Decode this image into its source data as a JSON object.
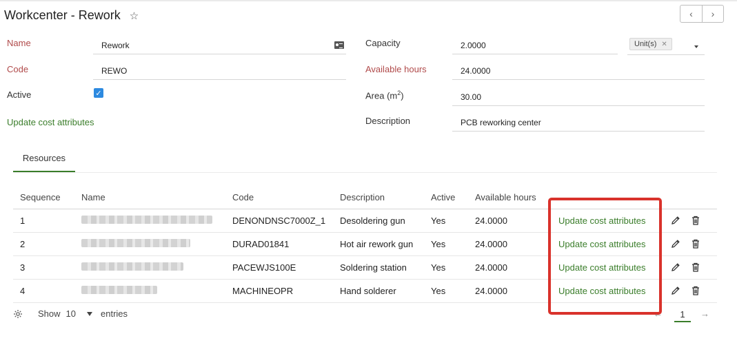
{
  "header": {
    "title": "Workcenter - Rework"
  },
  "form": {
    "name_label": "Name",
    "name_value": "Rework",
    "code_label": "Code",
    "code_value": "REWO",
    "active_label": "Active",
    "update_cost_link": "Update cost attributes",
    "capacity_label": "Capacity",
    "capacity_value": "2.0000",
    "capacity_unit": "Unit(s)",
    "available_hours_label": "Available hours",
    "available_hours_value": "24.0000",
    "area_label": "Area (m",
    "area_sup": "2",
    "area_label_end": ")",
    "area_value": "30.00",
    "description_label": "Description",
    "description_value": "PCB reworking center"
  },
  "tabs": {
    "resources": "Resources"
  },
  "table": {
    "headers": {
      "sequence": "Sequence",
      "name": "Name",
      "code": "Code",
      "description": "Description",
      "active": "Active",
      "available_hours": "Available hours"
    },
    "rows": [
      {
        "sequence": "1",
        "code": "DENONDNSC7000Z_1",
        "description": "Desoldering gun",
        "active": "Yes",
        "hours": "24.0000",
        "action": "Update cost attributes"
      },
      {
        "sequence": "2",
        "code": "DURAD01841",
        "description": "Hot air rework gun",
        "active": "Yes",
        "hours": "24.0000",
        "action": "Update cost attributes"
      },
      {
        "sequence": "3",
        "code": "PACEWJS100E",
        "description": "Soldering station",
        "active": "Yes",
        "hours": "24.0000",
        "action": "Update cost attributes"
      },
      {
        "sequence": "4",
        "code": "MACHINEOPR",
        "description": "Hand solderer",
        "active": "Yes",
        "hours": "24.0000",
        "action": "Update cost attributes"
      }
    ]
  },
  "footer": {
    "show": "Show",
    "page_size": "10",
    "entries": "entries",
    "current_page": "1"
  },
  "colors": {
    "accent_green": "#3a7d2a",
    "required_label": "#b04a4a",
    "checkbox_blue": "#2d8ae0",
    "highlight_red": "#d9322b"
  },
  "icons": [
    "star-icon",
    "chevron-left-icon",
    "chevron-right-icon",
    "id-card-icon",
    "check-icon",
    "remove-tag-icon",
    "caret-down-icon",
    "pencil-icon",
    "trash-icon",
    "gear-icon",
    "arrow-left-icon",
    "arrow-right-icon"
  ]
}
